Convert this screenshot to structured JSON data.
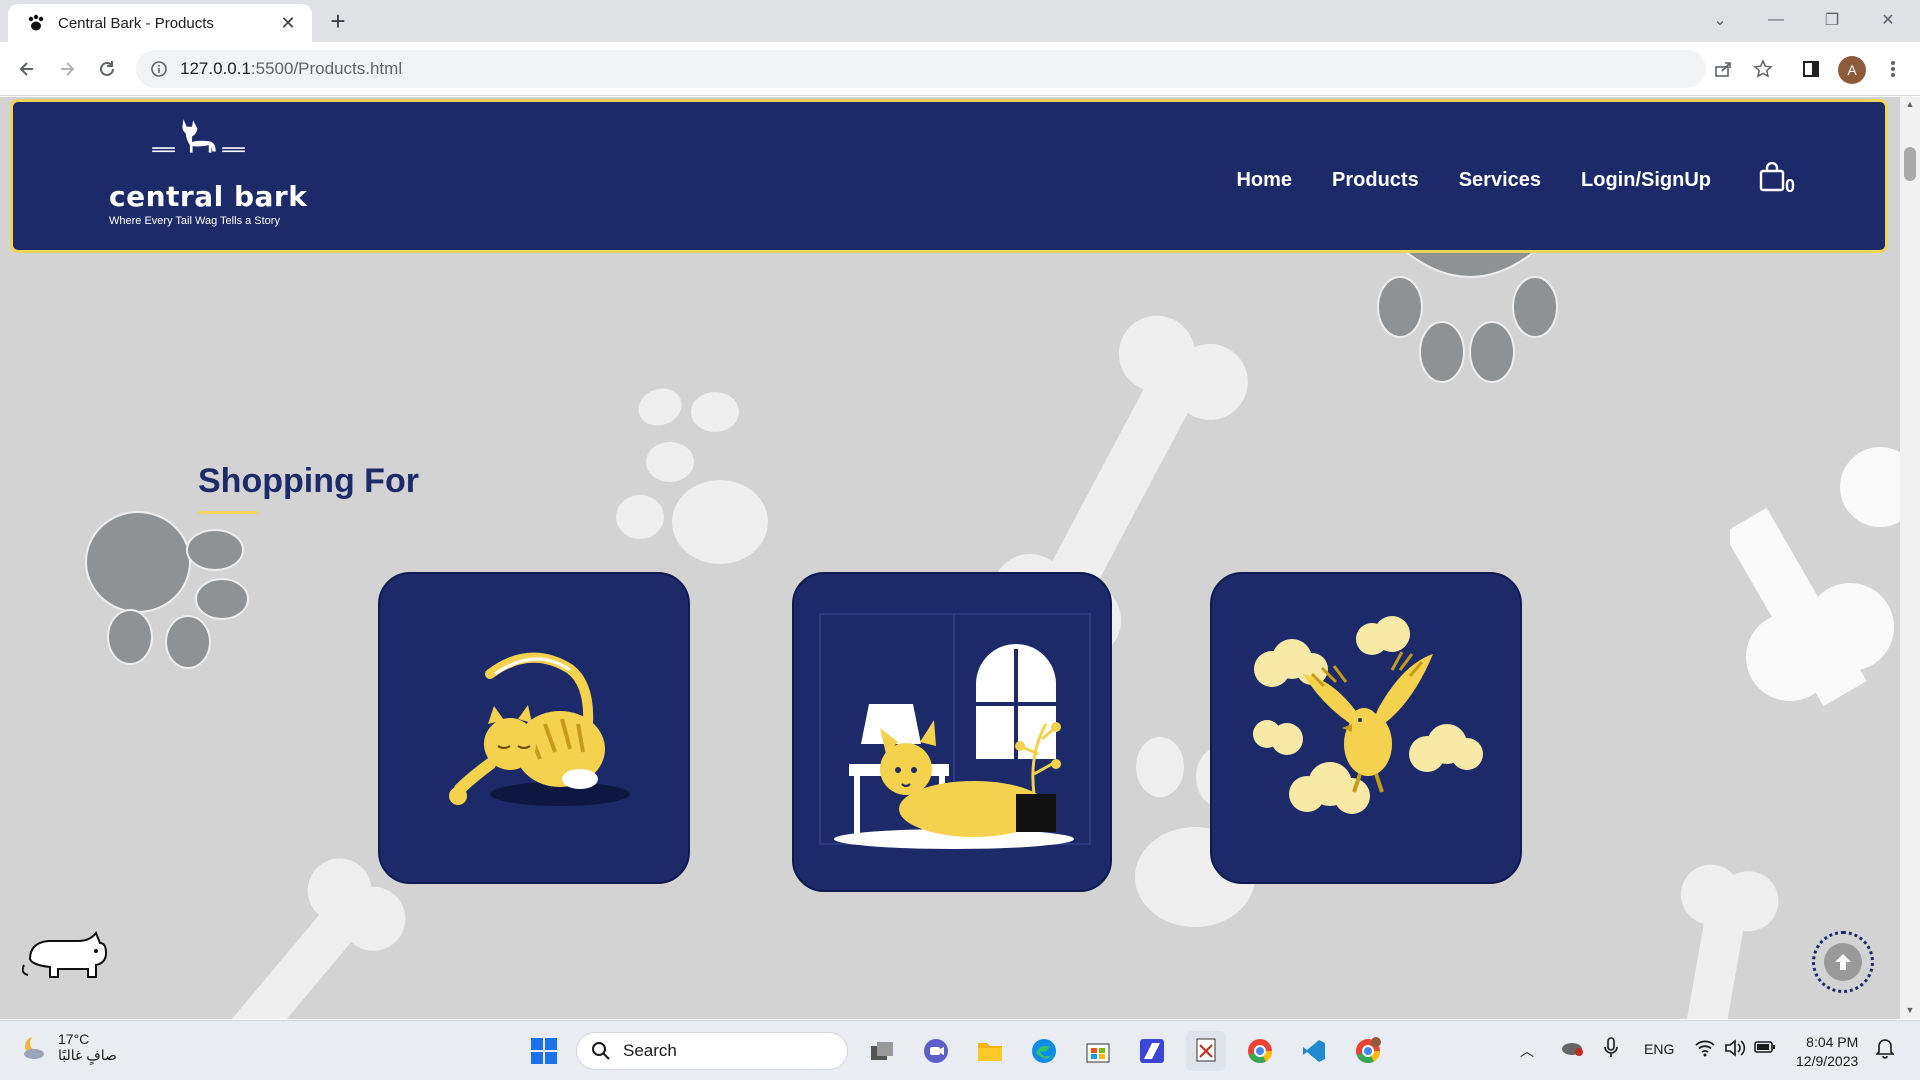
{
  "browser": {
    "tab_title": "Central Bark - Products",
    "url_host": "127.0.0.1",
    "url_rest": ":5500/Products.html",
    "avatar_letter": "A"
  },
  "site": {
    "logo_name": "central bark",
    "logo_tagline": "Where Every Tail Wag Tells a Story",
    "nav": {
      "home": "Home",
      "products": "Products",
      "services": "Services",
      "login": "Login/SignUp"
    },
    "cart_count": "0",
    "section_title": "Shopping For",
    "cards": [
      "cat",
      "dog",
      "bird"
    ],
    "colors": {
      "navy": "#1c2a69",
      "yellow": "#f3d45a",
      "background": "#d3d3d3"
    }
  },
  "taskbar": {
    "temperature": "17°C",
    "weather_text": "صافٍ غالبًا",
    "search_label": "Search",
    "language": "ENG",
    "time": "8:04 PM",
    "date": "12/9/2023"
  }
}
